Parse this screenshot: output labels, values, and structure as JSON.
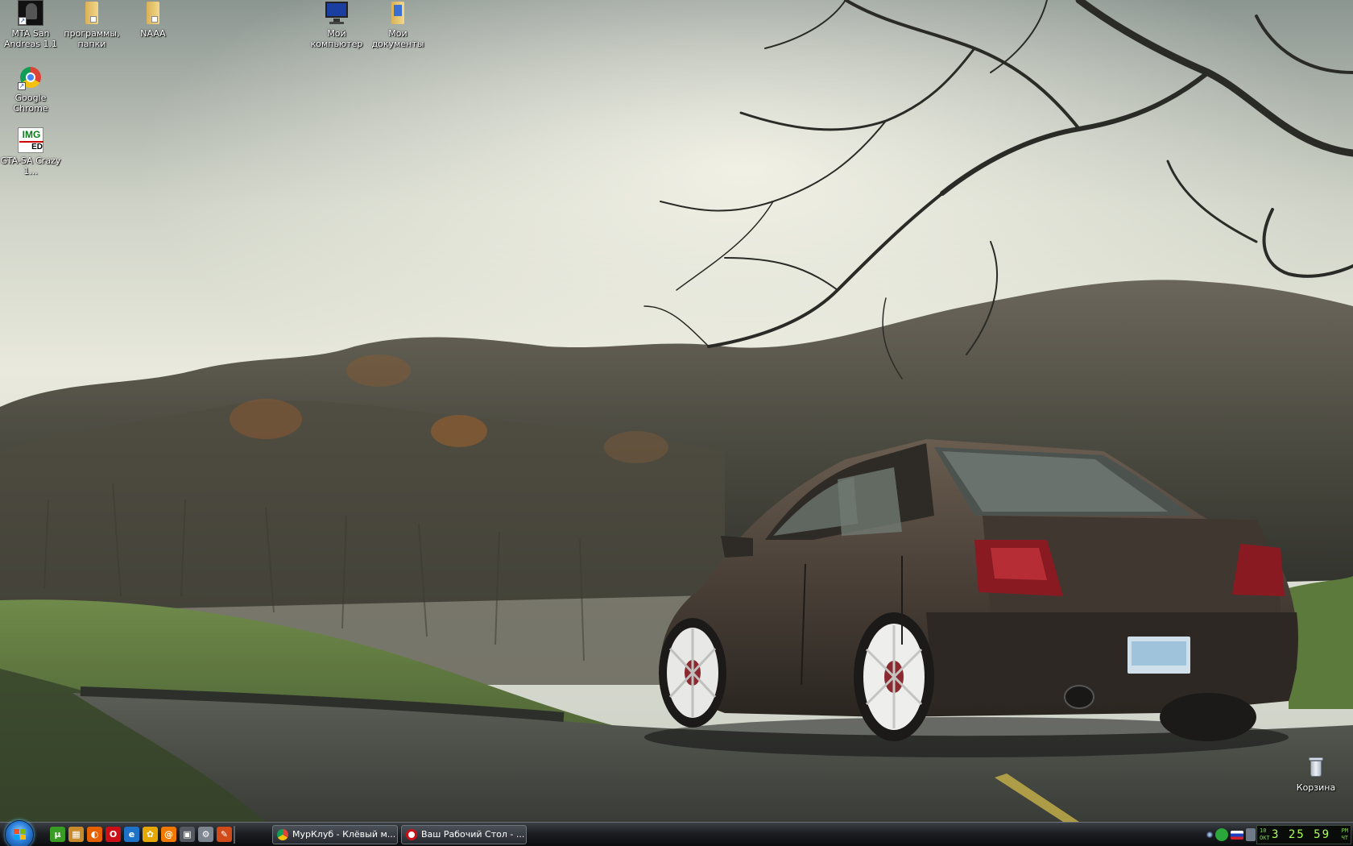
{
  "desktop": {
    "icons": [
      {
        "label": "MTA San Andreas 1.1",
        "icon": "mta-icon"
      },
      {
        "label": "программы, папки",
        "icon": "folder-icon"
      },
      {
        "label": "NAAA",
        "icon": "folder-icon"
      },
      {
        "label": "Мой компьютер",
        "icon": "my-computer-icon"
      },
      {
        "label": "Мои документы",
        "icon": "my-documents-icon"
      },
      {
        "label": "Google Chrome",
        "icon": "chrome-icon"
      },
      {
        "label": "GTA-SA Crazy 1...",
        "icon": "img-editor-icon"
      },
      {
        "label": "Корзина",
        "icon": "recycle-bin-icon"
      }
    ],
    "img_editor_badge": {
      "top": "IMG",
      "bottom": "ED"
    }
  },
  "taskbar": {
    "start_icon": "windows-orb-icon",
    "quick_launch": [
      {
        "icon": "utorrent-icon",
        "color": "#3a9d23",
        "glyph": "µ"
      },
      {
        "icon": "show-desktop-icon",
        "color": "#c98a2c",
        "glyph": "▦"
      },
      {
        "icon": "firefox-icon",
        "color": "#e66000",
        "glyph": "◐"
      },
      {
        "icon": "opera-icon",
        "color": "#cc0f16",
        "glyph": "O"
      },
      {
        "icon": "internet-explorer-icon",
        "color": "#1e73c8",
        "glyph": "e"
      },
      {
        "icon": "icq-icon",
        "color": "#e6a800",
        "glyph": "✿"
      },
      {
        "icon": "mail-agent-icon",
        "color": "#f07a00",
        "glyph": "@"
      },
      {
        "icon": "screenshot-icon",
        "color": "#555a62",
        "glyph": "▣"
      },
      {
        "icon": "settings-icon",
        "color": "#7d8590",
        "glyph": "⚙"
      },
      {
        "icon": "notepad-icon",
        "color": "#d04a1a",
        "glyph": "✎"
      }
    ],
    "tasks": [
      {
        "label": "МурКлуб - Клёвый м...",
        "icon": "chrome-icon"
      },
      {
        "label": "Ваш Рабочий Стол - ...",
        "icon": "opera-icon"
      }
    ],
    "tray": {
      "icons": [
        "network-icon",
        "antivirus-icon",
        "language-flag-icon",
        "volume-icon",
        "mail-agent-icon"
      ],
      "clock": {
        "date_top": "10",
        "date_bottom": "ОКТ",
        "time": "3 25 59",
        "ampm_top": "PM",
        "ampm_bottom": "ЧТ"
      }
    }
  }
}
